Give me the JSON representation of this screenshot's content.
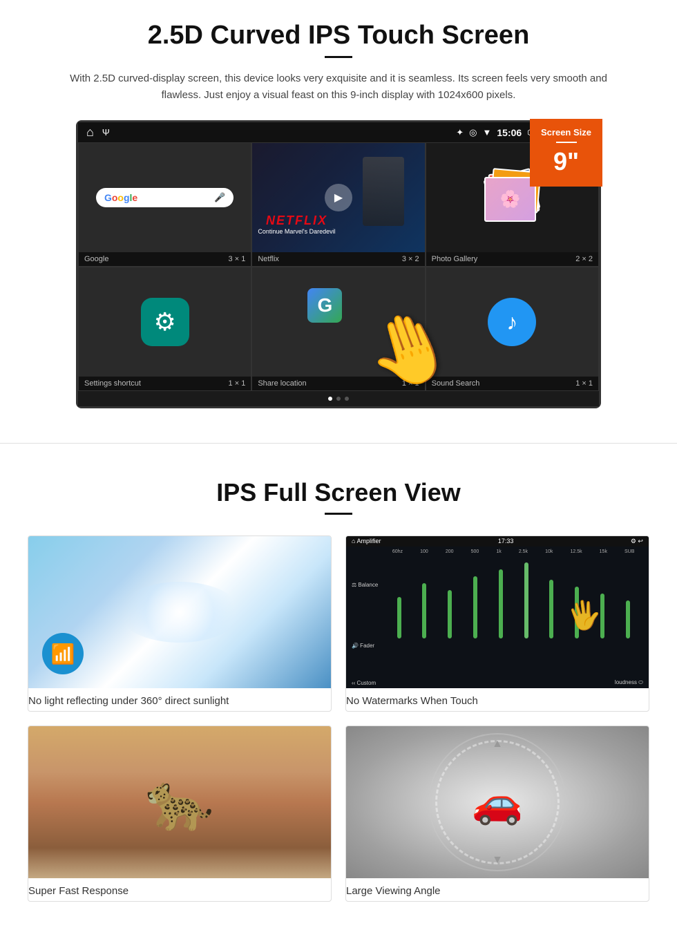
{
  "section1": {
    "title": "2.5D Curved IPS Touch Screen",
    "description": "With 2.5D curved-display screen, this device looks very exquisite and it is seamless. Its screen feels very smooth and flawless. Just enjoy a visual feast on this 9-inch display with 1024x600 pixels.",
    "badge": {
      "label": "Screen Size",
      "size": "9\"",
      "unit": ""
    },
    "statusBar": {
      "time": "15:06",
      "icons": [
        "bluetooth",
        "location",
        "wifi",
        "camera",
        "volume",
        "close",
        "window",
        "back"
      ]
    },
    "apps": [
      {
        "name": "Google",
        "grid": "3 × 1",
        "type": "google"
      },
      {
        "name": "Netflix",
        "grid": "3 × 2",
        "type": "netflix",
        "subtitle": "Continue Marvel's Daredevil"
      },
      {
        "name": "Photo Gallery",
        "grid": "2 × 2",
        "type": "gallery"
      },
      {
        "name": "Settings shortcut",
        "grid": "1 × 1",
        "type": "settings"
      },
      {
        "name": "Share location",
        "grid": "1 × 1",
        "type": "share"
      },
      {
        "name": "Sound Search",
        "grid": "1 × 1",
        "type": "sound"
      }
    ]
  },
  "section2": {
    "title": "IPS Full Screen View",
    "features": [
      {
        "caption": "No light reflecting under 360° direct sunlight",
        "type": "sunlight"
      },
      {
        "caption": "No Watermarks When Touch",
        "type": "amplifier"
      },
      {
        "caption": "Super Fast Response",
        "type": "cheetah"
      },
      {
        "caption": "Large Viewing Angle",
        "type": "car"
      }
    ]
  },
  "amplifier": {
    "title": "Amplifier",
    "time": "17:33",
    "freqLabels": [
      "60hz",
      "100hz",
      "200hz",
      "500hz",
      "1k",
      "2.5k",
      "10k",
      "12.5k",
      "15k",
      "SUB"
    ],
    "sliderHeights": [
      60,
      80,
      70,
      90,
      100,
      110,
      85,
      75,
      65,
      55
    ],
    "labels": [
      "Balance",
      "Fader"
    ],
    "bottomLeft": "Custom",
    "bottomRight": "loudness"
  }
}
